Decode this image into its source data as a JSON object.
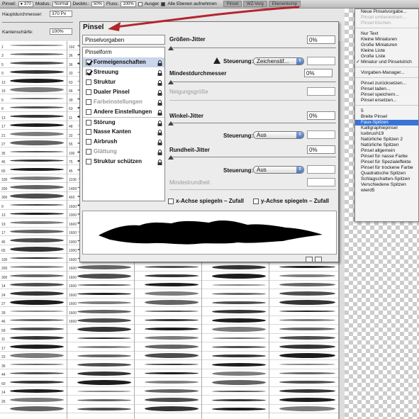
{
  "optionsBar": {
    "pinsel_label": "Pinsel:",
    "brush_size": "370",
    "modus_label": "Modus:",
    "modus_value": "Normal",
    "deckkr_label": "Deckkr.:",
    "deckkr_value": "50%",
    "fluss_label": "Fluss:",
    "fluss_value": "100%",
    "airbrush_label": "Ausger",
    "alle_label": "Alle Ebenen aufnehmen",
    "tabs": [
      "Pinsel",
      "WZ-Vorg",
      "Ebenenkomp"
    ]
  },
  "leftPanel": {
    "durchmesser_label": "Hauptdurchmesser:",
    "durchmesser_value": "370 Px",
    "kantenschaerfe_label": "Kantenschärfe:",
    "kantenschaerfe_value": "100%"
  },
  "dialog": {
    "title": "Pinsel",
    "presets_button": "Pinselvorgaben",
    "options": [
      {
        "label": "Pinselform",
        "type": "head"
      },
      {
        "label": "Formeigenschaften",
        "checked": true,
        "selected": true,
        "lock": true
      },
      {
        "label": "Streuung",
        "checked": true,
        "lock": true
      },
      {
        "label": "Struktur",
        "checked": false,
        "lock": true
      },
      {
        "label": "Dualer Pinsel",
        "checked": false,
        "lock": true
      },
      {
        "label": "Farbeinstellungen",
        "checked": false,
        "disabled": true,
        "lock": true
      },
      {
        "label": "Andere Einstellungen",
        "checked": false,
        "lock": true
      },
      {
        "label": "Störung",
        "checked": false,
        "lock": true,
        "sep": true
      },
      {
        "label": "Nasse Kanten",
        "checked": false,
        "lock": true
      },
      {
        "label": "Airbrush",
        "checked": false,
        "lock": true
      },
      {
        "label": "Glättung",
        "checked": false,
        "disabled": true,
        "lock": true
      },
      {
        "label": "Struktur schützen",
        "checked": false,
        "lock": true
      }
    ],
    "groessen_jitter_label": "Größen-Jitter",
    "groessen_jitter_value": "0%",
    "steuerung_label": "Steuerung:",
    "steuerung1_value": "Zeichenstif...",
    "mindestdurchmesser_label": "Mindestdurchmesser",
    "mindestdurchmesser_value": "0%",
    "neigungsgroesse_label": "Neigungsgröße",
    "winkel_jitter_label": "Winkel-Jitter",
    "winkel_jitter_value": "0%",
    "steuerung2_value": "Aus",
    "rundheit_jitter_label": "Rundheit-Jitter",
    "rundheit_jitter_value": "0%",
    "steuerung3_value": "Aus",
    "mindestrundheit_label": "Mindestrundheit",
    "x_spiegeln_label": "x-Achse spiegeln – Zufall",
    "y_spiegeln_label": "y-Achse spiegeln – Zufall"
  },
  "menu": {
    "items": [
      {
        "label": "Neue Pinselvorgabe..."
      },
      {
        "label": "Pinsel umbenennen...",
        "disabled": true
      },
      {
        "label": "Pinsel löschen",
        "disabled": true
      },
      {
        "sep": true
      },
      {
        "label": "Nur Text"
      },
      {
        "label": "Kleine Miniaturen"
      },
      {
        "label": "Große Miniaturen"
      },
      {
        "label": "Kleine Liste"
      },
      {
        "label": "Große Liste"
      },
      {
        "label": "Miniatur und Pinselstrich",
        "checked": true
      },
      {
        "sep": true
      },
      {
        "label": "Vorgaben-Manager..."
      },
      {
        "sep": true
      },
      {
        "label": "Pinsel zurücksetzen..."
      },
      {
        "label": "Pinsel laden..."
      },
      {
        "label": "Pinsel speichern..."
      },
      {
        "label": "Pinsel ersetzen..."
      },
      {
        "sep": true
      },
      {
        "label": "5"
      },
      {
        "label": "Breite Pinsel"
      },
      {
        "label": "Faux-Spitzen",
        "highlight": true
      },
      {
        "label": "Kalligraphiepinsel"
      },
      {
        "label": "luxbrush19"
      },
      {
        "label": "Natürliche Spitzen 2"
      },
      {
        "label": "Natürliche Spitzen"
      },
      {
        "label": "Pinsel allgemein"
      },
      {
        "label": "Pinsel für nasse Farbe"
      },
      {
        "label": "Pinsel für Spezialeffekte"
      },
      {
        "label": "Pinsel für trockene Farbe"
      },
      {
        "label": "Quadratische Spitzen"
      },
      {
        "label": "Schlagschatten-Spitzen"
      },
      {
        "label": "Verschiedene Spitzen"
      },
      {
        "label": "wierd5"
      }
    ]
  },
  "brushGrid": {
    "col1_numbers": [
      "1",
      "3",
      "5",
      "9",
      "13",
      "19",
      "5",
      "9",
      "13",
      "17",
      "21",
      "27",
      "35",
      "45",
      "65",
      "100",
      "200",
      "300",
      "9",
      "13",
      "19",
      "17",
      "45",
      "65",
      "100",
      "200",
      "300",
      "14",
      "24",
      "27",
      "39",
      "46",
      "59",
      "11",
      "17",
      "23",
      "36",
      "44",
      "60",
      "14",
      "26"
    ],
    "col2_numbers": [
      "192",
      "36",
      "36",
      "33",
      "63",
      "66",
      "39",
      "63",
      "11",
      "48",
      "32",
      "55",
      "100",
      "75",
      "45",
      "1106",
      "1499",
      "493",
      "1600",
      "1000",
      "1600",
      "1600",
      "1000",
      "1000",
      "1600",
      "1600",
      "1600",
      "1600",
      "1600",
      "1600",
      "1600",
      "1600"
    ]
  },
  "colors": {
    "highlight": "#3874d6",
    "selection": "#c8d5ea",
    "annotation_arrow": "#b3262d"
  }
}
